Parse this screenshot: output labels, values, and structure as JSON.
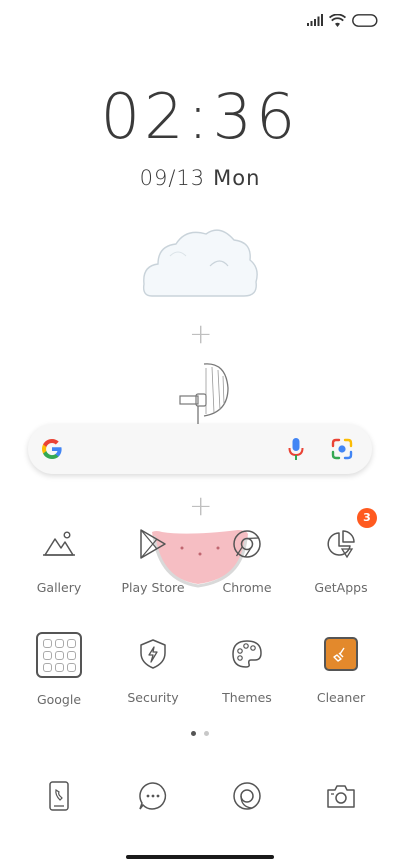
{
  "status_bar": {
    "signal_icon": "signal-icon",
    "wifi_icon": "wifi-icon",
    "battery_icon": "battery-icon"
  },
  "clock": {
    "time": "02:36",
    "date_numeric": "09/13",
    "weekday": "Mon"
  },
  "search_bar": {
    "logo_icon": "google-g-icon",
    "voice_icon": "mic-icon",
    "lens_icon": "google-lens-icon"
  },
  "apps": [
    {
      "label": "Gallery",
      "icon": "gallery-icon"
    },
    {
      "label": "Play Store",
      "icon": "play-store-icon"
    },
    {
      "label": "Chrome",
      "icon": "chrome-icon"
    },
    {
      "label": "GetApps",
      "icon": "getapps-icon",
      "badge": "3"
    },
    {
      "label": "Google",
      "icon": "google-folder-icon"
    },
    {
      "label": "Security",
      "icon": "security-icon"
    },
    {
      "label": "Themes",
      "icon": "themes-icon"
    },
    {
      "label": "Cleaner",
      "icon": "cleaner-icon"
    }
  ],
  "pager": {
    "total": 2,
    "active": 1
  },
  "dock": [
    {
      "icon": "phone-icon"
    },
    {
      "icon": "messages-icon"
    },
    {
      "icon": "browser-icon"
    },
    {
      "icon": "camera-icon"
    }
  ],
  "colors": {
    "badge": "#ff5a1f",
    "cleaner": "#e3892c",
    "text": "#3a3a3a"
  }
}
